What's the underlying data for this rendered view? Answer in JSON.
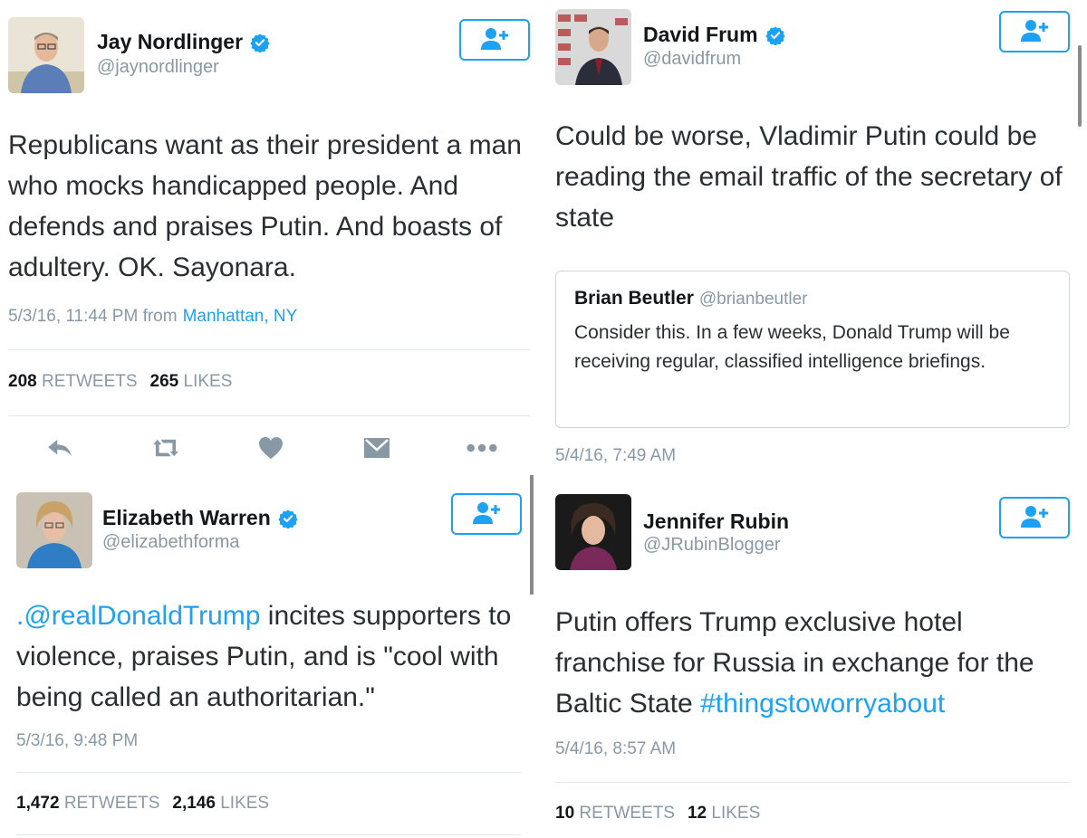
{
  "tweets": {
    "nordlinger": {
      "name": "Jay Nordlinger",
      "handle": "@jaynordlinger",
      "text": "Republicans want as their president a man who mocks handicapped people. And defends and praises Putin. And boasts of adultery. OK. Sayonara.",
      "time": "5/3/16, 11:44 PM from",
      "place": "Manhattan, NY",
      "retweets": "208",
      "retweets_label": "RETWEETS",
      "likes": "265",
      "likes_label": "LIKES"
    },
    "frum": {
      "name": "David Frum",
      "handle": "@davidfrum",
      "text": "Could be worse, Vladimir Putin could be reading the email traffic of the secretary of state",
      "quote": {
        "name": "Brian Beutler",
        "handle": "@brianbeutler",
        "text": "Consider this. In a few weeks, Donald Trump will be receiving regular, classified intelligence briefings."
      },
      "time": "5/4/16, 7:49 AM"
    },
    "warren": {
      "name": "Elizabeth Warren",
      "handle": "@elizabethforma",
      "text_mention": ".@realDonaldTrump",
      "text_rest": " incites supporters to violence, praises Putin, and is \"cool with being called an authoritarian.\"",
      "time": "5/3/16, 9:48 PM",
      "retweets": "1,472",
      "retweets_label": "RETWEETS",
      "likes": "2,146",
      "likes_label": "LIKES"
    },
    "rubin": {
      "name": "Jennifer Rubin",
      "handle": "@JRubinBlogger",
      "text_main": "Putin offers Trump exclusive hotel franchise for Russia in exchange for the Baltic State ",
      "text_hashtag": "#thingstoworryabout",
      "time": "5/4/16, 8:57 AM",
      "retweets": "10",
      "retweets_label": "RETWEETS",
      "likes": "12",
      "likes_label": "LIKES"
    }
  },
  "icons": [
    "verified-badge-icon",
    "follow-person-plus-icon",
    "reply-icon",
    "retweet-icon",
    "like-heart-icon",
    "direct-message-icon",
    "more-dots-icon"
  ],
  "colors": {
    "accent": "#1da1f2",
    "muted": "#8899a6",
    "icon_gray": "#8899a6",
    "text": "#292f33"
  }
}
